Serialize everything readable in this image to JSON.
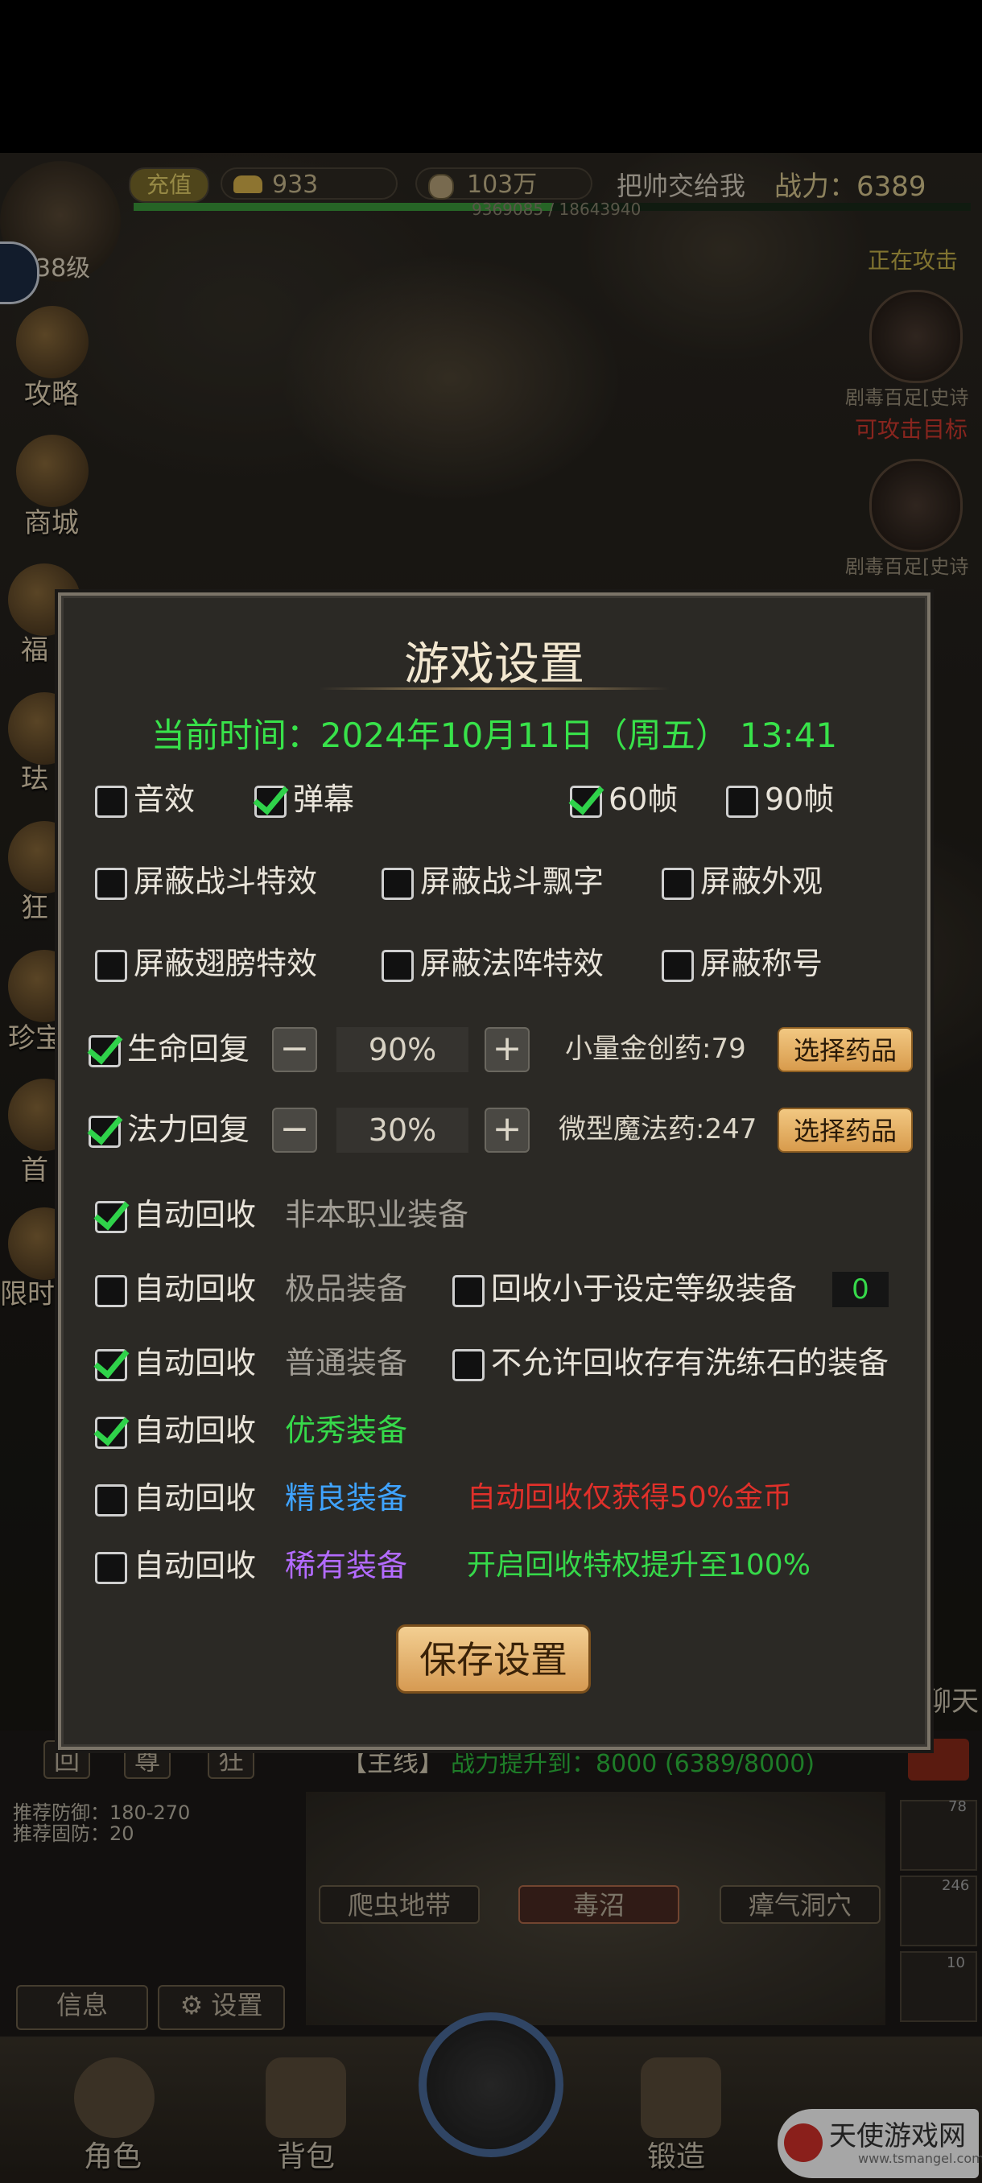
{
  "hud": {
    "recharge_label": "充值",
    "gold": "933",
    "coins": "103万",
    "player_name": "把帅交给我",
    "power_label": "战力：6389",
    "exp_text": "9369085 / 18643940",
    "level": "38级",
    "attacking": "正在攻击",
    "target1": "剧毒百足[史诗",
    "attackable": "可攻击目标",
    "target2": "剧毒百足[史诗"
  },
  "side_menu": [
    "攻略",
    "商城",
    "福",
    "珐",
    "狂",
    "珍宝",
    "首",
    "限时"
  ],
  "dialog": {
    "title": "游戏设置",
    "time_text": "当前时间：2024年10月11日（周五） 13:41",
    "row1": [
      {
        "label": "音效",
        "checked": false
      },
      {
        "label": "弹幕",
        "checked": true
      },
      {
        "label": "60帧",
        "checked": true
      },
      {
        "label": "90帧",
        "checked": false
      }
    ],
    "row2": [
      {
        "label": "屏蔽战斗特效",
        "checked": false
      },
      {
        "label": "屏蔽战斗飘字",
        "checked": false
      },
      {
        "label": "屏蔽外观",
        "checked": false
      }
    ],
    "row3": [
      {
        "label": "屏蔽翅膀特效",
        "checked": false
      },
      {
        "label": "屏蔽法阵特效",
        "checked": false
      },
      {
        "label": "屏蔽称号",
        "checked": false
      }
    ],
    "hp": {
      "label": "生命回复",
      "checked": true,
      "value": "90%",
      "potion": "小量金创药:79",
      "button": "选择药品"
    },
    "mp": {
      "label": "法力回复",
      "checked": true,
      "value": "30%",
      "potion": "微型魔法药:247",
      "button": "选择药品"
    },
    "recycle": [
      {
        "label": "自动回收",
        "checked": true,
        "type": "非本职业装备"
      },
      {
        "label": "自动回收",
        "checked": false,
        "type": "极品装备",
        "extra_label": "回收小于设定等级装备",
        "extra_checked": false,
        "extra_value": "0"
      },
      {
        "label": "自动回收",
        "checked": true,
        "type": "普通装备",
        "extra_label": "不允许回收存有洗练石的装备",
        "extra_checked": false
      },
      {
        "label": "自动回收",
        "checked": true,
        "type": "优秀装备"
      },
      {
        "label": "自动回收",
        "checked": false,
        "type": "精良装备",
        "note": "自动回收仅获得50%金币"
      },
      {
        "label": "自动回收",
        "checked": false,
        "type": "稀有装备",
        "note": "开启回收特权提升至100%"
      }
    ],
    "save_button": "保存设置"
  },
  "bottom": {
    "quick_tabs": [
      "回",
      "尊",
      "狂"
    ],
    "quest_tag": "【主线】",
    "quest_text": "战力提升到：8000 (6389/8000)",
    "chat_label": "聊天",
    "info_lines": [
      "推荐防御：180-270",
      "推荐固防：20"
    ],
    "locations": [
      "爬虫地带",
      "毒沼",
      "瘴气洞穴"
    ],
    "info_button": "信息",
    "settings_button": "设置",
    "nav": [
      "角色",
      "背包",
      "锻造"
    ],
    "watermark": "天使游戏网",
    "watermark_url": "www.tsmangel.com",
    "item_counts": [
      "78",
      "246",
      "10"
    ]
  }
}
